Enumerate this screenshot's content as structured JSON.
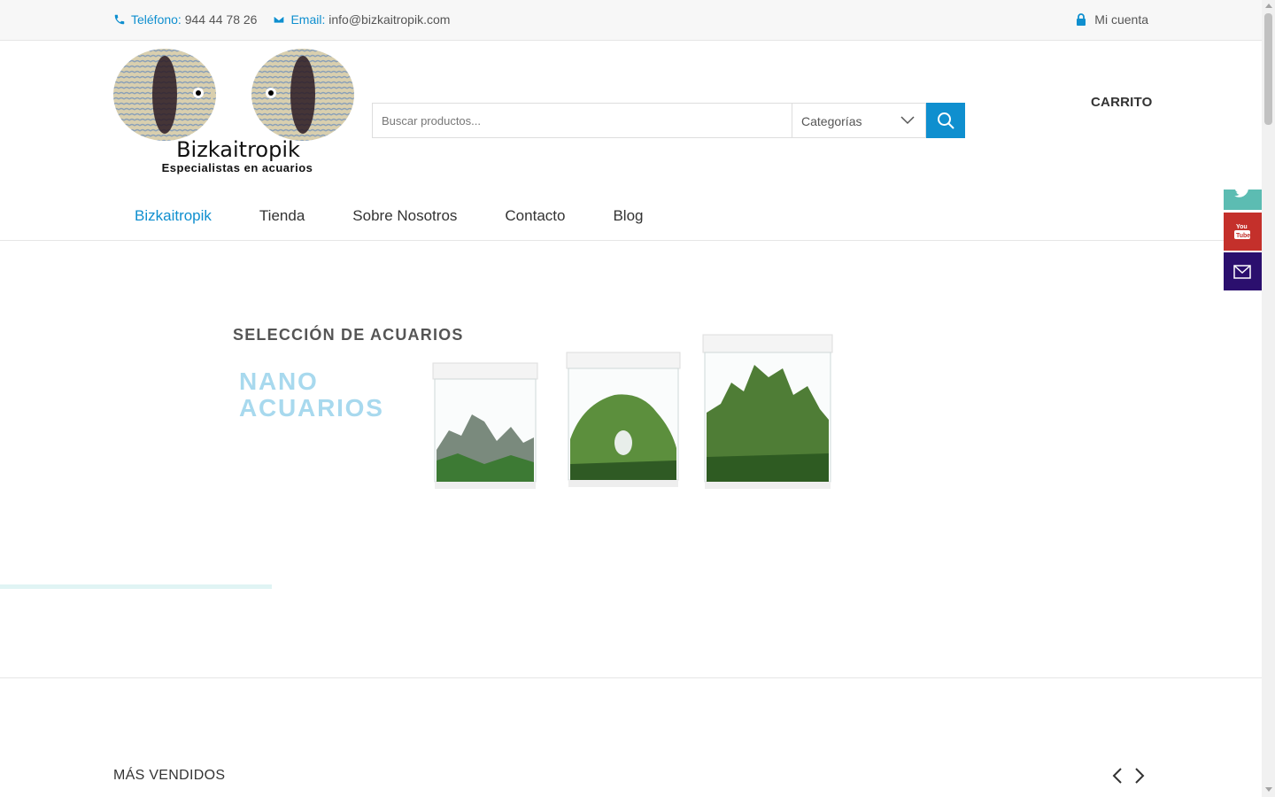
{
  "topbar": {
    "phone_label": "Teléfono:",
    "phone_value": "944 44 78 26",
    "email_label": "Email:",
    "email_value": "info@bizkaitropik.com",
    "account": "Mi cuenta"
  },
  "logo": {
    "name": "Bizkaitropik",
    "tagline": "Especialistas en acuarios"
  },
  "search": {
    "placeholder": "Buscar productos...",
    "category": "Categorías"
  },
  "cart": "CARRITO",
  "nav": [
    "Bizkaitropik",
    "Tienda",
    "Sobre Nosotros",
    "Contacto",
    "Blog"
  ],
  "hero": {
    "heading": "SELECCIÓN DE ACUARIOS",
    "subheading": "NANO\nACUARIOS"
  },
  "section": {
    "title": "MÁS VENDIDOS"
  },
  "colors": {
    "accent": "#0f8fcf",
    "youtube": "#c4302b",
    "twitter": "#5cbcb2",
    "email": "#2b0f6e"
  },
  "icons": [
    "phone-icon",
    "envelope-icon",
    "lock-icon",
    "search-icon",
    "chevron-down-icon",
    "twitter-icon",
    "youtube-icon",
    "mail-icon",
    "arrow-left-icon",
    "arrow-right-icon"
  ]
}
